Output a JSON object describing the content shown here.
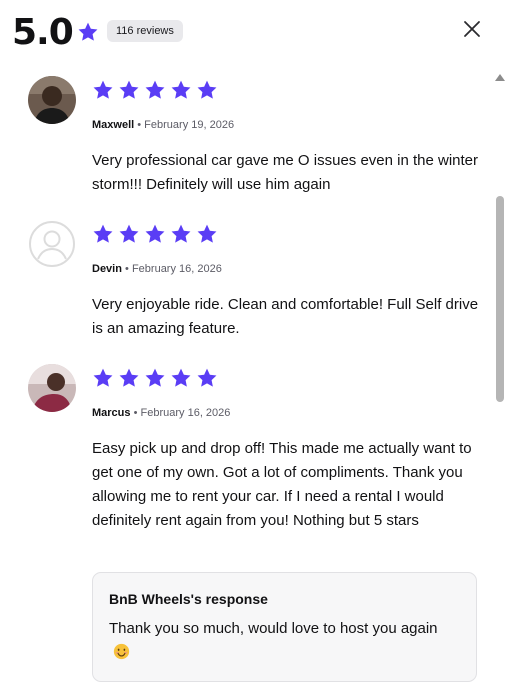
{
  "header": {
    "rating": "5.0",
    "reviews_count_label": "116 reviews",
    "close_icon": "close-icon"
  },
  "colors": {
    "star": "#5a3df5",
    "text": "#121214",
    "muted": "#5c5c66",
    "pill": "#e9e9ec",
    "response_bg": "#f7f7f8"
  },
  "reviews": [
    {
      "author": "Maxwell",
      "separator": "•",
      "date": "February 19, 2026",
      "stars": 5,
      "avatar": "photo",
      "text": "Very professional car gave me O issues even in the winter storm!!! Definitely will use him again"
    },
    {
      "author": "Devin",
      "separator": "•",
      "date": "February 16, 2026",
      "stars": 5,
      "avatar": "default-user-icon",
      "text": "Very enjoyable ride. Clean and comfortable! Full Self drive is an amazing feature."
    },
    {
      "author": "Marcus",
      "separator": "•",
      "date": "February 16, 2026",
      "stars": 5,
      "avatar": "photo",
      "text": "Easy pick up and drop off! This made me actually want to get one of my own. Got a lot of compliments. Thank you allowing me to rent your car. If I need a rental I would definitely rent again from you! Nothing but 5 stars",
      "response": {
        "title": "BnB Wheels's response",
        "text": "Thank you so much, would love to host you again",
        "emoji": "smiling-face-emoji"
      }
    }
  ]
}
